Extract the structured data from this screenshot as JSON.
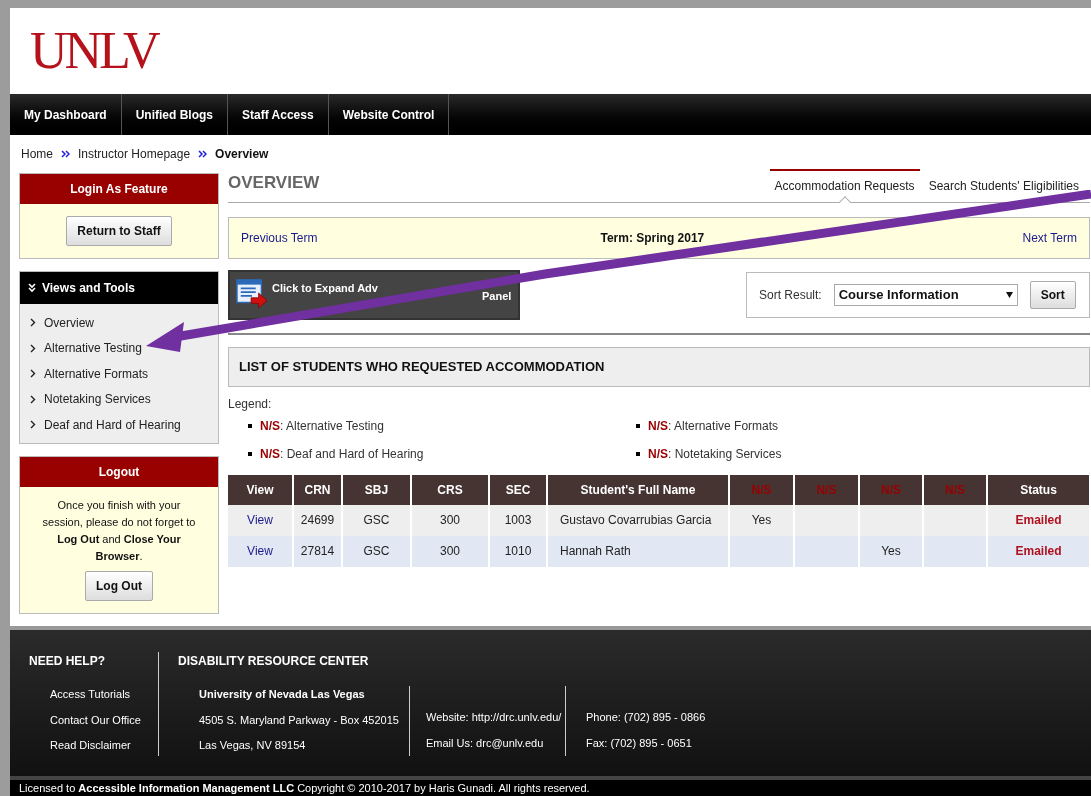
{
  "logo": "UNLV",
  "nav": [
    {
      "label": "My Dashboard"
    },
    {
      "label": "Unified Blogs"
    },
    {
      "label": "Staff Access"
    },
    {
      "label": "Website Control"
    }
  ],
  "breadcrumb": [
    "Home",
    "Instructor Homepage",
    "Overview"
  ],
  "login_as": {
    "title": "Login As Feature",
    "button": "Return to Staff"
  },
  "views_and_tools": {
    "title": "Views and Tools",
    "items": [
      "Overview",
      "Alternative Testing",
      "Alternative Formats",
      "Notetaking Services",
      "Deaf and Hard of Hearing"
    ]
  },
  "logout": {
    "title": "Logout",
    "message": "Once you finish with your session, please do not forget to **Log Out** and **Close Your Browser**.",
    "button": "Log Out"
  },
  "page_title": "OVERVIEW",
  "tabs": [
    {
      "label": "Accommodation Requests",
      "selected": true
    },
    {
      "label": "Search Students' Eligibilities",
      "selected": false
    }
  ],
  "term_bar": {
    "previous": "Previous Term",
    "term": "Term: Spring 2017",
    "next": "Next Term"
  },
  "search_panel_button": [
    "Click to Expand Adv",
    "Panel"
  ],
  "sort": {
    "label": "Sort Result:",
    "value": "Course Information",
    "button": "Sort"
  },
  "list_title": "LIST OF STUDENTS WHO REQUESTED ACCOMMODATION",
  "legend": {
    "title": "Legend:",
    "items": [
      {
        "code": "N/S",
        "text": ": Alternative Testing"
      },
      {
        "code": "N/S",
        "text": ": Alternative Formats"
      },
      {
        "code": "N/S",
        "text": ": Deaf and Hard of Hearing"
      },
      {
        "code": "N/S",
        "text": ": Notetaking Services"
      }
    ]
  },
  "table": {
    "columns": [
      {
        "label": "View",
        "kind": "link"
      },
      {
        "label": "CRN",
        "kind": "plain"
      },
      {
        "label": "SBJ",
        "kind": "plain"
      },
      {
        "label": "CRS",
        "kind": "plain"
      },
      {
        "label": "SEC",
        "kind": "plain"
      },
      {
        "label": "Student's Full Name",
        "kind": "name"
      },
      {
        "label": "N/S",
        "kind": "code"
      },
      {
        "label": "N/S",
        "kind": "code"
      },
      {
        "label": "N/S",
        "kind": "code"
      },
      {
        "label": "N/S",
        "kind": "code"
      },
      {
        "label": "Status",
        "kind": "status"
      }
    ],
    "rows": [
      {
        "cells": [
          "View",
          "24699",
          "GSC",
          "300",
          "1003",
          "Gustavo Covarrubias Garcia",
          "Yes",
          "",
          "",
          "",
          "Emailed"
        ]
      },
      {
        "cells": [
          "View",
          "27814",
          "GSC",
          "300",
          "1010",
          "Hannah Rath",
          "",
          "",
          "Yes",
          "",
          "Emailed"
        ]
      }
    ]
  },
  "footer": {
    "help_title": "NEED HELP?",
    "help_links": [
      "Access Tutorials",
      "Contact Our Office",
      "Read Disclaimer"
    ],
    "center_title": "DISABILITY RESOURCE CENTER",
    "address": [
      "University of Nevada Las Vegas",
      "4505 S. Maryland Parkway - Box 452015",
      "Las Vegas, NV 89154"
    ],
    "web": [
      "Website: http://drc.unlv.edu/",
      "Email Us: drc@unlv.edu"
    ],
    "phone": [
      "Phone: (702) 895 - 0866",
      "Fax: (702) 895 - 0651"
    ],
    "copyright": "Licensed to **Accessible Information Management LLC** Copyright © 2010-2017 by Haris Gunadi. All rights reserved."
  }
}
